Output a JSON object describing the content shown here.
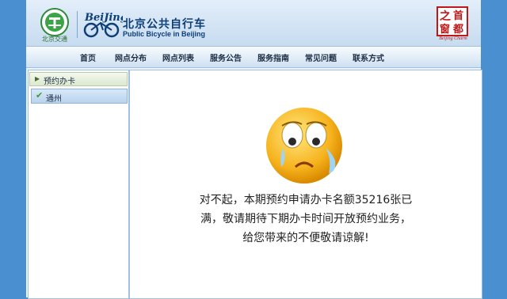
{
  "header": {
    "logo_bjjt_label": "北京交通",
    "brand_cn": "北京公共自行车",
    "brand_en": "Public Bicycle in Beijing",
    "logo_shoudu_chars": [
      "之",
      "首",
      "窗",
      "都"
    ],
    "logo_shoudu_sub": "Beijing Charm"
  },
  "nav": {
    "items": [
      "首页",
      "网点分布",
      "网点列表",
      "服务公告",
      "服务指南",
      "常见问题",
      "联系方式"
    ]
  },
  "sidebar": {
    "title": "预约办卡",
    "items": [
      {
        "label": "通州",
        "icon": "check-icon"
      }
    ]
  },
  "main": {
    "icon": "crying-face-icon",
    "message_lines": [
      "对不起，本期预约申请办卡名额35216张已",
      "满，敬请期待下期办卡时间开放预约业务，",
      "给您带来的不便敬请谅解!"
    ]
  },
  "colors": {
    "page_bg": "#4a8fcf",
    "brand_blue": "#0d3f77",
    "shoudu_red": "#c01818"
  }
}
